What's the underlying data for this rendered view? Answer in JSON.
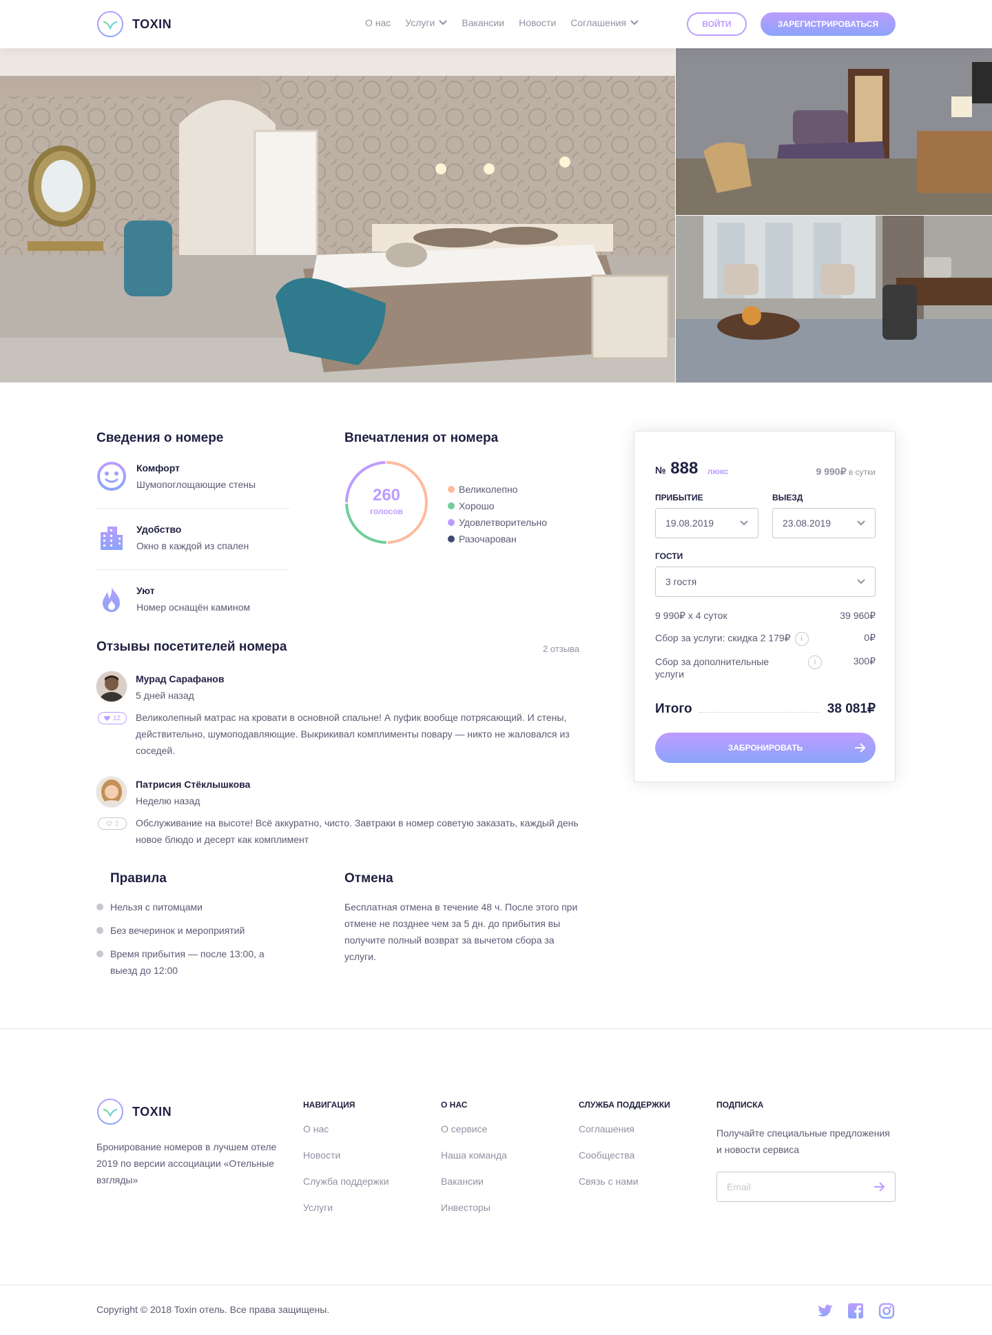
{
  "brand": {
    "name": "TOXIN",
    "footer_name": "TOXIN"
  },
  "nav": {
    "items": [
      {
        "label": "О нас",
        "dropdown": false
      },
      {
        "label": "Услуги",
        "dropdown": true
      },
      {
        "label": "Вакансии",
        "dropdown": false
      },
      {
        "label": "Новости",
        "dropdown": false
      },
      {
        "label": "Соглашения",
        "dropdown": true
      }
    ],
    "login": "ВОЙТИ",
    "register": "ЗАРЕГИСТРИРОВАТЬСЯ"
  },
  "room_info": {
    "title": "Сведения о номере",
    "features": [
      {
        "icon": "smile-icon",
        "title": "Комфорт",
        "desc": "Шумопоглощающие стены"
      },
      {
        "icon": "building-icon",
        "title": "Удобство",
        "desc": "Окно в каждой из спален"
      },
      {
        "icon": "fire-icon",
        "title": "Уют",
        "desc": "Номер оснащён камином"
      }
    ]
  },
  "impressions": {
    "title": "Впечатления от номера",
    "votes": "260",
    "votes_label": "голосов",
    "legend": [
      {
        "label": "Великолепно",
        "color": "#ffba9c",
        "value": 130
      },
      {
        "label": "Хорошо",
        "color": "#6fcf97",
        "value": 65
      },
      {
        "label": "Удовлетворительно",
        "color": "#bc9cff",
        "value": 65
      },
      {
        "label": "Разочарован",
        "color": "#3d4975",
        "value": 0
      }
    ]
  },
  "reviews": {
    "title": "Отзывы посетителей номера",
    "count": "2 отзыва",
    "items": [
      {
        "name": "Мурад Сарафанов",
        "date": "5 дней назад",
        "likes": "12",
        "liked": true,
        "text": "Великолепный матрас на кровати в основной спальне! А пуфик вообще потрясающий. И стены, действительно, шумоподавляющие. Выкрикивал комплименты повару — никто не жаловался из соседей."
      },
      {
        "name": "Патрисия Стёклышкова",
        "date": "Неделю назад",
        "likes": "2",
        "liked": false,
        "text": "Обслуживание на высоте! Всё аккуратно, чисто. Завтраки в номер советую заказать, каждый день новое блюдо и десерт как комплимент"
      }
    ]
  },
  "rules": {
    "title": "Правила",
    "items": [
      "Нельзя с питомцами",
      "Без вечеринок и мероприятий",
      "Время прибытия — после 13:00, а выезд до 12:00"
    ]
  },
  "cancel": {
    "title": "Отмена",
    "text": "Бесплатная отмена в течение 48 ч. После этого при отмене не позднее чем за 5 дн. до прибытия вы получите полный возврат за вычетом сбора за услуги."
  },
  "booking": {
    "number_prefix": "№",
    "number": "888",
    "type": "люкс",
    "price": "9 990₽",
    "price_suffix": "в сутки",
    "arrival_label": "ПРИБЫТИЕ",
    "arrival": "19.08.2019",
    "departure_label": "ВЫЕЗД",
    "departure": "23.08.2019",
    "guests_label": "ГОСТИ",
    "guests": "3 гостя",
    "calc_label": "9 990₽ х 4 суток",
    "calc_value": "39 960₽",
    "fee_label": "Сбор за услуги: скидка 2 179₽",
    "fee_value": "0₽",
    "extra_label": "Сбор за дополнительные услуги",
    "extra_value": "300₽",
    "info_glyph": "i",
    "total_label": "Итого",
    "total_value": "38 081₽",
    "book_button": "ЗАБРОНИРОВАТЬ"
  },
  "footer": {
    "description": "Бронирование номеров в лучшем отеле 2019 по версии ассоциации «Отельные взгляды»",
    "columns": [
      {
        "title": "НАВИГАЦИЯ",
        "links": [
          "О нас",
          "Новости",
          "Служба поддержки",
          "Услуги"
        ]
      },
      {
        "title": "О НАС",
        "links": [
          "О сервисе",
          "Наша команда",
          "Вакансии",
          "Инвесторы"
        ]
      },
      {
        "title": "СЛУЖБА ПОДДЕРЖКИ",
        "links": [
          "Соглашения",
          "Сообщества",
          "Связь с нами"
        ]
      }
    ],
    "subscribe_title": "ПОДПИСКА",
    "subscribe_text": "Получайте специальные предложения и новости сервиса",
    "email_placeholder": "Email",
    "copyright": "Copyright © 2018 Toxin отель. Все права защищены.",
    "social": [
      "twitter-icon",
      "facebook-icon",
      "instagram-icon"
    ]
  },
  "colors": {
    "accent": "#bc9cff",
    "accent2": "#8ba4f9",
    "text": "#1f2041",
    "green": "#6fcf97",
    "orange": "#ffba9c"
  }
}
